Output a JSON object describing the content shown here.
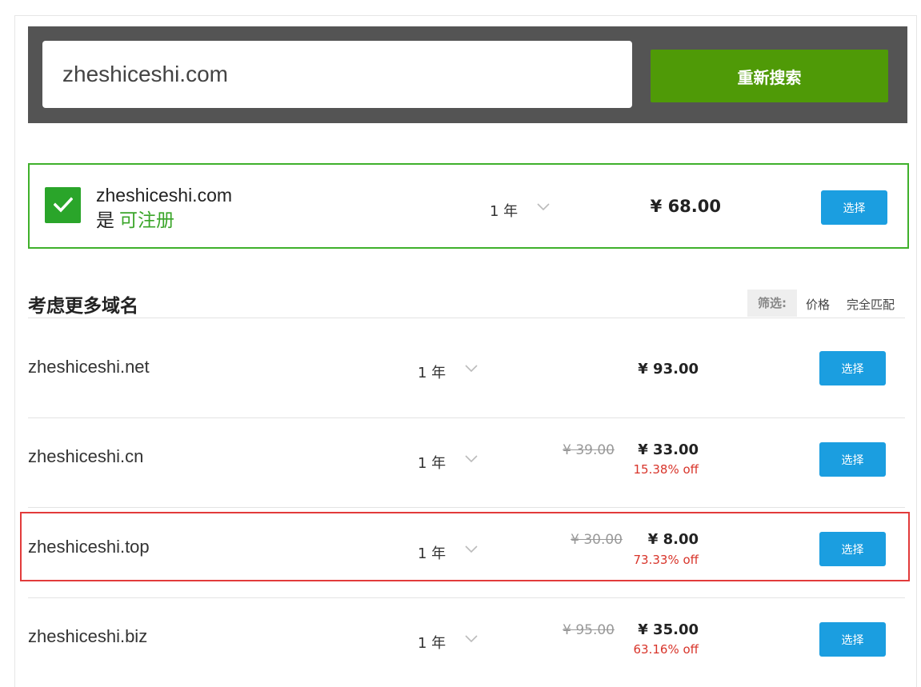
{
  "search": {
    "value": "zheshiceshi.com",
    "button_label": "重新搜索"
  },
  "available": {
    "domain": "zheshiceshi.com",
    "status_prefix": "是",
    "status_text": "可注册",
    "years": "1 年",
    "price": "¥ 68.00",
    "select_label": "选择"
  },
  "more": {
    "title": "考虑更多域名",
    "filter_label": "筛选:",
    "filter_options": [
      "价格",
      "完全匹配"
    ]
  },
  "rows": [
    {
      "domain": "zheshiceshi.net",
      "years": "1 年",
      "old_price": "",
      "price": "¥ 93.00",
      "discount": "",
      "select_label": "选择"
    },
    {
      "domain": "zheshiceshi.cn",
      "years": "1 年",
      "old_price": "¥ 39.00",
      "price": "¥ 33.00",
      "discount": "15.38% off",
      "select_label": "选择"
    },
    {
      "domain": "zheshiceshi.top",
      "years": "1 年",
      "old_price": "¥ 30.00",
      "price": "¥ 8.00",
      "discount": "73.33% off",
      "select_label": "选择"
    },
    {
      "domain": "zheshiceshi.biz",
      "years": "1 年",
      "old_price": "¥ 95.00",
      "price": "¥ 35.00",
      "discount": "63.16% off",
      "select_label": "选择"
    }
  ],
  "colors": {
    "search_band": "#545454",
    "search_button": "#4f9a07",
    "available_border": "#3fb02b",
    "select_button": "#1b9ee0",
    "discount_text": "#d8342a",
    "highlight_border": "#e23b3b"
  },
  "icons": {
    "available": "check-icon",
    "dropdown": "chevron-down-icon"
  }
}
